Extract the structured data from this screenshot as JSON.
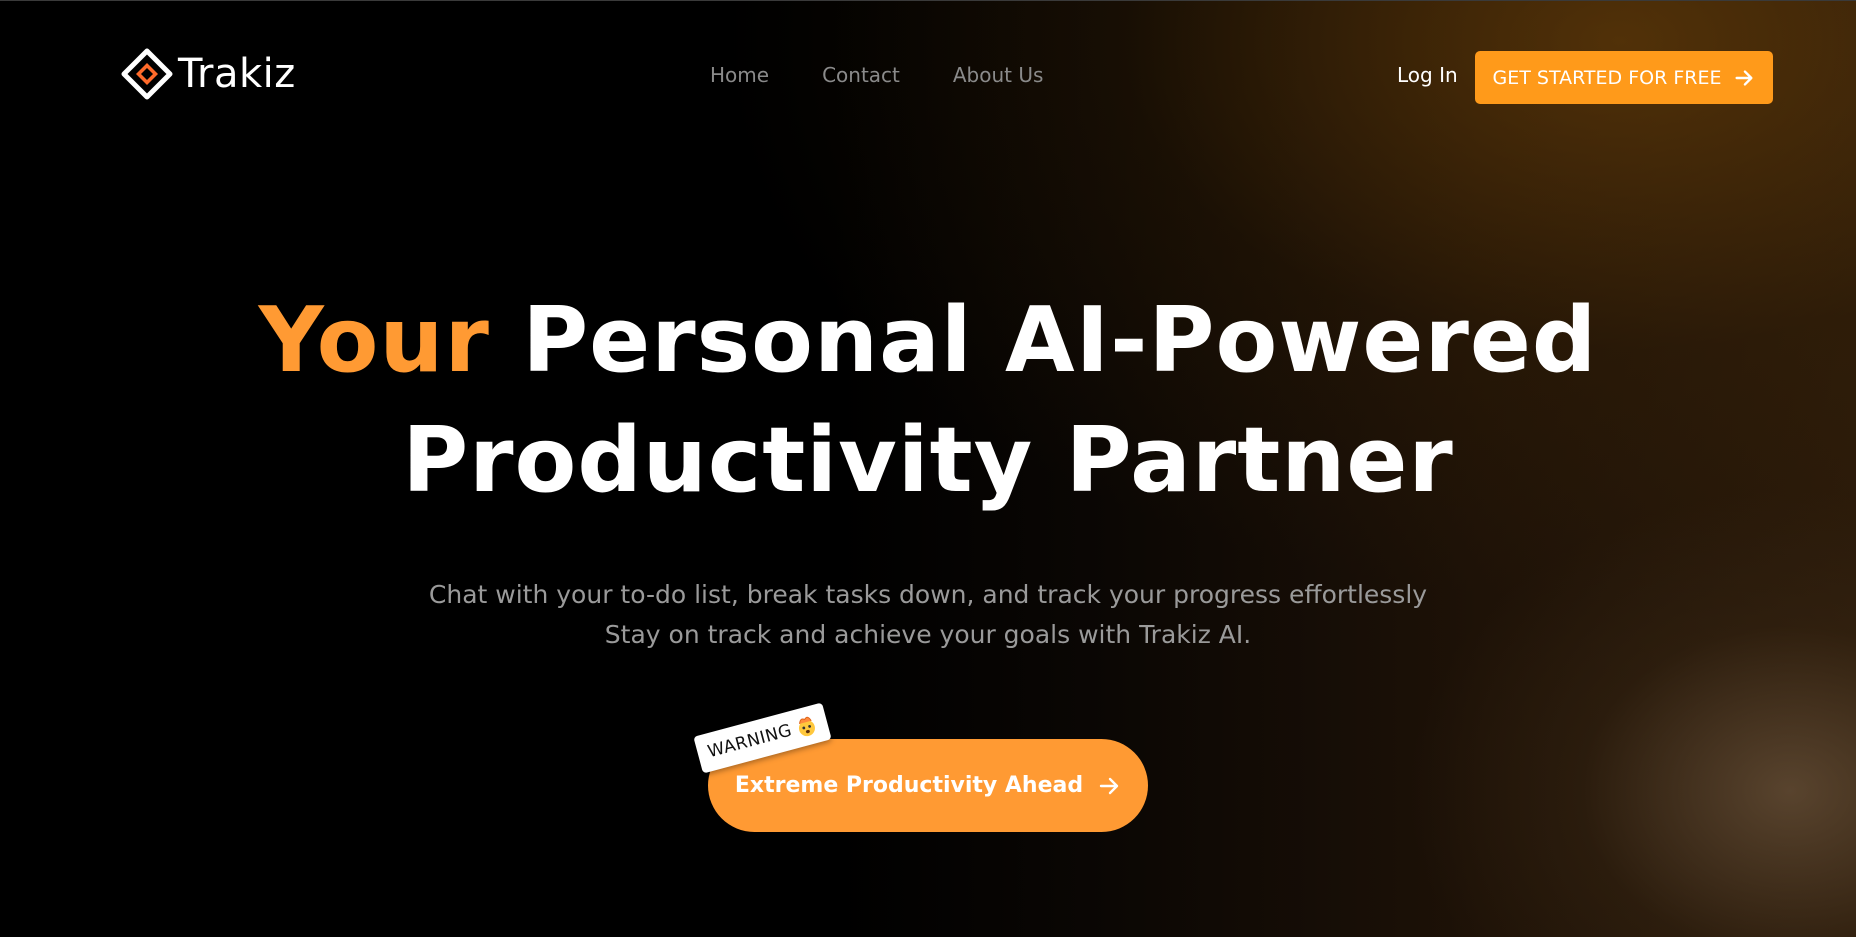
{
  "brand": {
    "name": "Trakiz",
    "accent_color": "#ff9a33"
  },
  "nav": {
    "items": [
      {
        "label": "Home"
      },
      {
        "label": "Contact"
      },
      {
        "label": "About Us"
      }
    ],
    "login_label": "Log In",
    "cta_label": "GET STARTED FOR FREE",
    "cta_icon": "arrow-right-icon"
  },
  "hero": {
    "title_accent": "Your",
    "title_rest_line1": "Personal AI-Powered",
    "title_line2": "Productivity Partner",
    "subtitle_line1": "Chat with your to-do list, break tasks down, and track your progress effortlessly",
    "subtitle_line2": "Stay on track and achieve your goals with Trakiz AI.",
    "cta_label": "Extreme Productivity Ahead",
    "cta_icon": "arrow-right-icon",
    "badge_label": "WARNING",
    "badge_icon": "mind-blown-emoji-icon"
  }
}
